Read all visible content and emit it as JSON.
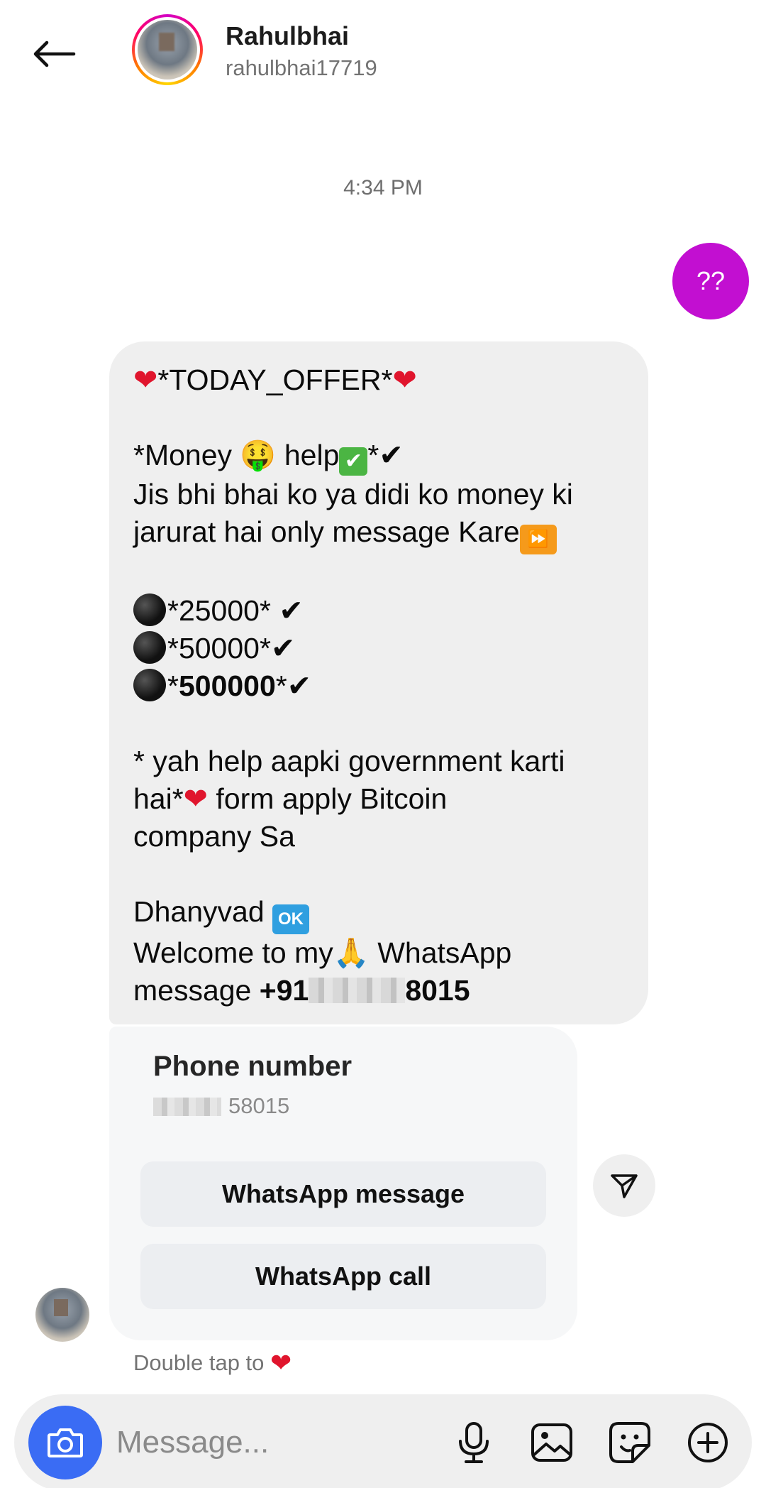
{
  "header": {
    "name": "Rahulbhai",
    "handle": "rahulbhai17719"
  },
  "timestamp": "4:34 PM",
  "outgoing": {
    "text": "??",
    "color": "#c20fd1"
  },
  "incoming": {
    "offer_title": "*TODAY_OFFER*",
    "money_pre": "*Money ",
    "money_help": " help",
    "money_post": "*",
    "body_line1": "Jis bhi bhai ko ya didi ko money ki",
    "body_line2": "jarurat hai only message Kare",
    "amount1": "*25000* ",
    "amount2": "*50000*",
    "amount3_pre": "*",
    "amount3_bold": "500000",
    "amount3_post": "*",
    "gov_line1": "* yah help aapki  government karti",
    "gov_line2_pre": "hai*",
    "gov_line2_post": " form apply Bitcoin",
    "gov_line3": "company Sa",
    "thanks": "Dhanyvad ",
    "ok_label": "OK",
    "welcome_pre": "Welcome to my",
    "welcome_post": " WhatsApp",
    "phone_prefix_label": "message ",
    "phone_start": "+91",
    "phone_end": "8015"
  },
  "card": {
    "title": "Phone number",
    "number_suffix": "58015",
    "btn_message": "WhatsApp message",
    "btn_call": "WhatsApp call"
  },
  "double_tap": "Double tap to",
  "composer": {
    "placeholder": "Message..."
  },
  "colors": {
    "accent_purple": "#c20fd1",
    "camera_blue": "#3a6cf4",
    "heart_red": "#e0152d"
  }
}
